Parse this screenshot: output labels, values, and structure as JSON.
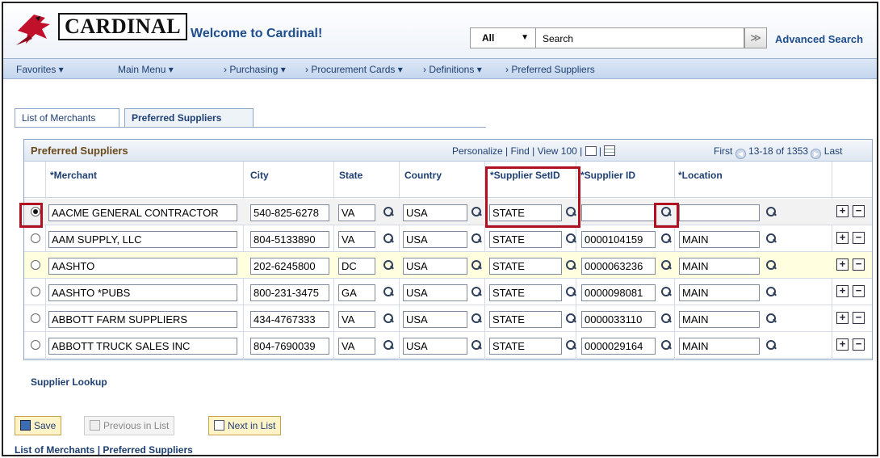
{
  "header": {
    "logo_text": "CARDINAL",
    "welcome": "Welcome to Cardinal!",
    "search_scope": "All",
    "search_placeholder": "Search",
    "search_go": "≫",
    "advanced_search": "Advanced Search"
  },
  "nav": {
    "favorites": "Favorites ▾",
    "main_menu": "Main Menu ▾",
    "crumbs": [
      "› Purchasing ▾",
      "› Procurement Cards ▾",
      "› Definitions ▾",
      "› Preferred Suppliers"
    ]
  },
  "tabs": [
    {
      "label": "List of Merchants",
      "active": false
    },
    {
      "label": "Preferred Suppliers",
      "active": true
    }
  ],
  "grid": {
    "title": "Preferred Suppliers",
    "personalize": "Personalize",
    "find": "Find",
    "view": "View 100",
    "first": "First",
    "range": "13-18 of 1353",
    "last": "Last",
    "columns": {
      "merchant": "*Merchant",
      "city": "City",
      "state": "State",
      "country": "Country",
      "setid": "*Supplier SetID",
      "supplier_id": "*Supplier ID",
      "location": "*Location"
    },
    "rows": [
      {
        "merchant": "AACME GENERAL CONTRACTOR",
        "city": "540-825-6278",
        "state": "VA",
        "country": "USA",
        "setid": "STATE",
        "supplier_id": "",
        "location": ""
      },
      {
        "merchant": "AAM SUPPLY, LLC",
        "city": "804-5133890",
        "state": "VA",
        "country": "USA",
        "setid": "STATE",
        "supplier_id": "0000104159",
        "location": "MAIN"
      },
      {
        "merchant": "AASHTO",
        "city": "202-6245800",
        "state": "DC",
        "country": "USA",
        "setid": "STATE",
        "supplier_id": "0000063236",
        "location": "MAIN"
      },
      {
        "merchant": "AASHTO *PUBS",
        "city": "800-231-3475",
        "state": "GA",
        "country": "USA",
        "setid": "STATE",
        "supplier_id": "0000098081",
        "location": "MAIN"
      },
      {
        "merchant": "ABBOTT FARM SUPPLIERS",
        "city": "434-4767333",
        "state": "VA",
        "country": "USA",
        "setid": "STATE",
        "supplier_id": "0000033110",
        "location": "MAIN"
      },
      {
        "merchant": "ABBOTT TRUCK SALES INC",
        "city": "804-7690039",
        "state": "VA",
        "country": "USA",
        "setid": "STATE",
        "supplier_id": "0000029164",
        "location": "MAIN"
      }
    ]
  },
  "supplier_lookup": "Supplier Lookup",
  "buttons": {
    "save": "Save",
    "previous": "Previous in List",
    "next": "Next in List"
  },
  "bottom_links": {
    "merchants": "List of Merchants",
    "separator": "|",
    "suppliers": "Preferred Suppliers"
  },
  "colors": {
    "accent": "#1e4e8c",
    "highlight_box": "#b01020",
    "row_highlight": "#ffffe0"
  }
}
